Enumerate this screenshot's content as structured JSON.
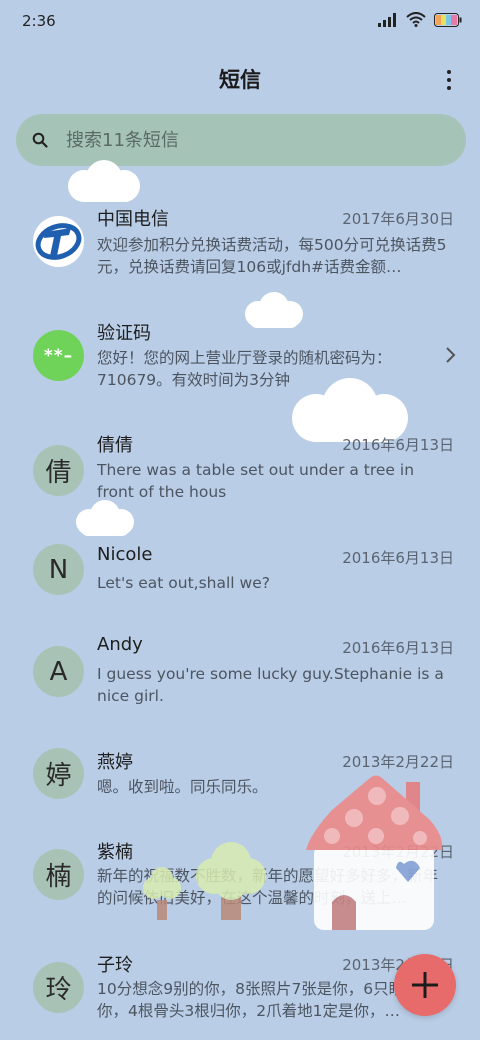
{
  "status": {
    "time": "2:36"
  },
  "header": {
    "title": "短信"
  },
  "search": {
    "placeholder": "搜索11条短信"
  },
  "messages": [
    {
      "sender": "中国电信",
      "date": "2017年6月30日",
      "preview": "欢迎参加积分兑换话费活动，每500分可兑换话费5元，兑换话费请回复106或jfdh#话费金额…",
      "avatar": "ct-logo-icon"
    },
    {
      "sender": "验证码",
      "date": "",
      "preview": "您好！您的网上营业厅登录的随机密码为：710679。有效时间为3分钟",
      "avatar_text": "**–"
    },
    {
      "sender": "倩倩",
      "date": "2016年6月13日",
      "preview": "There was a table set out under a tree in front of the hous",
      "avatar_text": "倩"
    },
    {
      "sender": "Nicole",
      "date": "2016年6月13日",
      "preview": "Let's eat out,shall we?",
      "avatar_text": "N"
    },
    {
      "sender": "Andy",
      "date": "2016年6月13日",
      "preview": "I guess you're some lucky guy.Stephanie is a nice girl.",
      "avatar_text": "A"
    },
    {
      "sender": "燕婷",
      "date": "2013年2月22日",
      "preview": "嗯。收到啦。同乐同乐。",
      "avatar_text": "婷"
    },
    {
      "sender": "紫楠",
      "date": "2013年2月22日",
      "preview": "新年的祝福数不胜数，新年的愿望好多好多，新年的问候依旧美好，在这个温馨的时刻，送上…",
      "avatar_text": "楠"
    },
    {
      "sender": "子玲",
      "date": "2013年2月22日",
      "preview": "10分想念9别的你，8张照片7张是你，6只眼睛只像你，4根骨头3根归你，2爪着地1定是你，…",
      "avatar_text": "玲"
    }
  ],
  "colors": {
    "background": "#b9cde6",
    "search_bg": "#a6c3b8",
    "avatar_bg": "#a8c3b6",
    "fab": "#e86b6b",
    "code_avatar": "#6fd35a"
  }
}
